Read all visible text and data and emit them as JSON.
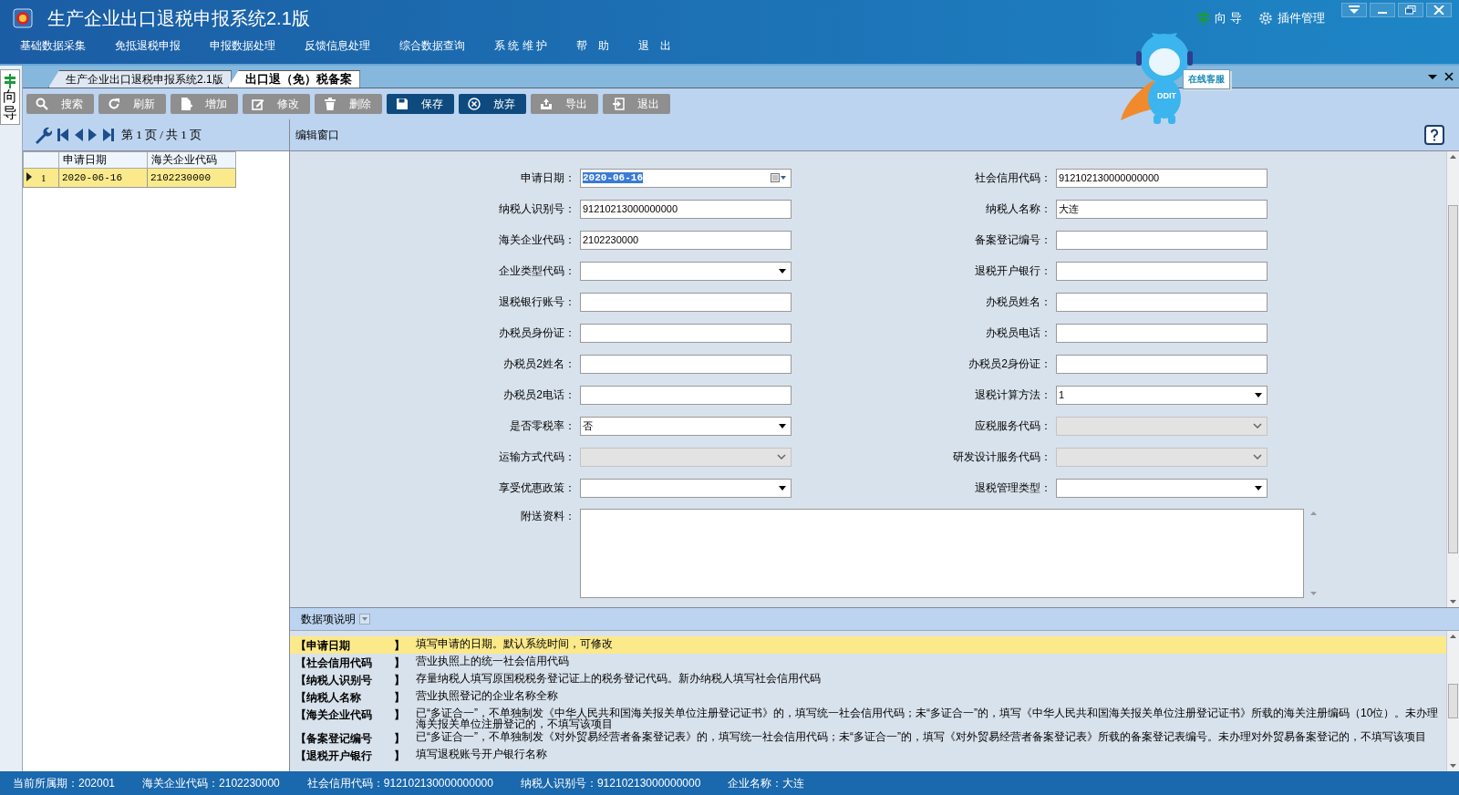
{
  "window": {
    "title": "生产企业出口退税申报系统2.1版"
  },
  "top_links": [
    {
      "label": "向 导",
      "kind": "guide"
    },
    {
      "label": "插件管理",
      "kind": "plugin"
    }
  ],
  "menu": [
    "基础数据采集",
    "免抵退税申报",
    "申报数据处理",
    "反馈信息处理",
    "综合数据查询",
    "系 统 维 护",
    "帮　助",
    "退　出"
  ],
  "mascot": {
    "badge": "DDIT",
    "sign": "在线客服"
  },
  "side_tab": {
    "label": "向导"
  },
  "tabs": [
    {
      "label": "生产企业出口退税申报系统2.1版",
      "selected": false
    },
    {
      "label": "出口退（免）税备案",
      "selected": true
    }
  ],
  "toolbar": [
    {
      "label": "搜索",
      "kind": "search",
      "disabled": true
    },
    {
      "label": "刷新",
      "kind": "refresh",
      "disabled": true
    },
    {
      "label": "增加",
      "kind": "add",
      "disabled": true
    },
    {
      "label": "修改",
      "kind": "edit",
      "disabled": true
    },
    {
      "label": "删除",
      "kind": "delete",
      "disabled": true
    },
    {
      "label": "保存",
      "kind": "save",
      "disabled": false
    },
    {
      "label": "放弃",
      "kind": "cancel",
      "disabled": false
    },
    {
      "label": "导出",
      "kind": "export",
      "disabled": true
    },
    {
      "label": "退出",
      "kind": "exit",
      "disabled": true
    }
  ],
  "pager": {
    "text": "第 1 页 / 共 1 页"
  },
  "grid": {
    "columns": [
      "申请日期",
      "海关企业代码"
    ],
    "rows": [
      {
        "index": "1",
        "cells": [
          "2020-06-16",
          "2102230000"
        ],
        "selected": true
      }
    ]
  },
  "editor": {
    "title": "编辑窗口",
    "fields": [
      {
        "label": "申请日期：",
        "kind": "date",
        "value": "2020-06-16",
        "disabled": false
      },
      {
        "label": "社会信用代码：",
        "kind": "text",
        "value": "912102130000000000",
        "disabled": false
      },
      {
        "label": "纳税人识别号：",
        "kind": "text",
        "value": "91210213000000000",
        "disabled": false
      },
      {
        "label": "纳税人名称：",
        "kind": "text",
        "value": "大连",
        "disabled": false
      },
      {
        "label": "海关企业代码：",
        "kind": "text",
        "value": "2102230000",
        "disabled": false
      },
      {
        "label": "备案登记编号：",
        "kind": "text",
        "disabled": false
      },
      {
        "label": "企业类型代码：",
        "kind": "select",
        "disabled": false
      },
      {
        "label": "退税开户银行：",
        "kind": "text",
        "disabled": false
      },
      {
        "label": "退税银行账号：",
        "kind": "text",
        "disabled": false
      },
      {
        "label": "办税员姓名：",
        "kind": "text",
        "disabled": false
      },
      {
        "label": "办税员身份证：",
        "kind": "text",
        "disabled": false
      },
      {
        "label": "办税员电话：",
        "kind": "text",
        "disabled": false
      },
      {
        "label": "办税员2姓名：",
        "kind": "text",
        "disabled": false
      },
      {
        "label": "办税员2身份证：",
        "kind": "text",
        "disabled": false
      },
      {
        "label": "办税员2电话：",
        "kind": "text",
        "disabled": false
      },
      {
        "label": "退税计算方法：",
        "kind": "select",
        "value": "1",
        "disabled": false
      },
      {
        "label": "是否零税率：",
        "kind": "select",
        "value": "否",
        "disabled": false
      },
      {
        "label": "应税服务代码：",
        "kind": "select",
        "disabled": true
      },
      {
        "label": "运输方式代码：",
        "kind": "select",
        "disabled": true
      },
      {
        "label": "研发设计服务代码：",
        "kind": "select",
        "disabled": true
      },
      {
        "label": "享受优惠政策：",
        "kind": "select",
        "disabled": false
      },
      {
        "label": "退税管理类型：",
        "kind": "select",
        "disabled": false
      }
    ],
    "attachment": {
      "label": "附送资料："
    }
  },
  "help": {
    "title": "数据项说明",
    "rows": [
      {
        "field": "【申请日期",
        "close": "】",
        "text": "填写申请的日期。默认系统时间，可修改",
        "selected": true
      },
      {
        "field": "【社会信用代码",
        "close": "】",
        "text": "营业执照上的统一社会信用代码",
        "selected": false
      },
      {
        "field": "【纳税人识别号",
        "close": "】",
        "text": "存量纳税人填写原国税税务登记证上的税务登记代码。新办纳税人填写社会信用代码",
        "selected": false
      },
      {
        "field": "【纳税人名称",
        "close": "】",
        "text": "营业执照登记的企业名称全称",
        "selected": false
      },
      {
        "field": "【海关企业代码",
        "close": "】",
        "text": "已“多证合一”，不单独制发《中华人民共和国海关报关单位注册登记证书》的，填写统一社会信用代码；未“多证合一”的，填写《中华人民共和国海关报关单位注册登记证书》所载的海关注册编码（10位）。未办理海关报关单位注册登记的，不填写该项目",
        "selected": false
      },
      {
        "field": "【备案登记编号",
        "close": "】",
        "text": "已“多证合一”，不单独制发《对外贸易经营者备案登记表》的，填写统一社会信用代码；未“多证合一”的，填写《对外贸易经营者备案登记表》所载的备案登记表编号。未办理对外贸易备案登记的，不填写该项目",
        "selected": false
      },
      {
        "field": "【退税开户银行",
        "close": "】",
        "text": "填写退税账号开户银行名称",
        "selected": false
      }
    ]
  },
  "status_bar": [
    "当前所属期：202001",
    "海关企业代码：2102230000",
    "社会信用代码：912102130000000000",
    "纳税人识别号：91210213000000000",
    "企业名称：大连"
  ]
}
